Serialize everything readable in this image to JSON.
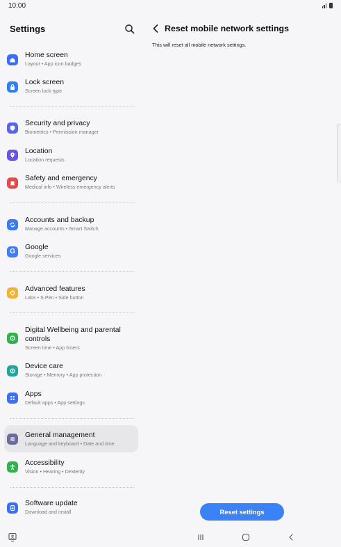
{
  "status": {
    "time": "10:00"
  },
  "left": {
    "title": "Settings",
    "items": [
      {
        "title": "Home screen",
        "subtitle": "Layout  •  App icon badges",
        "icon": "home-icon",
        "color": "#3b6ef5"
      },
      {
        "title": "Lock screen",
        "subtitle": "Screen lock type",
        "icon": "lock-icon",
        "color": "#2f80f0"
      },
      {
        "title": "Security and privacy",
        "subtitle": "Biometrics  •  Permission manager",
        "icon": "shield-icon",
        "color": "#5865e8"
      },
      {
        "title": "Location",
        "subtitle": "Location requests",
        "icon": "location-pin-icon",
        "color": "#6a55e0"
      },
      {
        "title": "Safety and emergency",
        "subtitle": "Medical info  •  Wireless emergency alerts",
        "icon": "emergency-icon",
        "color": "#e34a4a"
      },
      {
        "title": "Accounts and backup",
        "subtitle": "Manage accounts  •  Smart Switch",
        "icon": "sync-icon",
        "color": "#3a7cf0"
      },
      {
        "title": "Google",
        "subtitle": "Google services",
        "icon": "google-icon",
        "color": "#3d7ff2"
      },
      {
        "title": "Advanced features",
        "subtitle": "Labs  •  S Pen  •  Side button",
        "icon": "gear-plus-icon",
        "color": "#f2b233"
      },
      {
        "title": "Digital Wellbeing and parental controls",
        "subtitle": "Screen time  •  App timers",
        "icon": "wellbeing-icon",
        "color": "#2fb24c"
      },
      {
        "title": "Device care",
        "subtitle": "Storage  •  Memory  •  App protection",
        "icon": "device-care-icon",
        "color": "#1ea69a"
      },
      {
        "title": "Apps",
        "subtitle": "Default apps  •  App settings",
        "icon": "apps-grid-icon",
        "color": "#3d6ff0"
      },
      {
        "title": "General management",
        "subtitle": "Language and keyboard  •  Date and time",
        "icon": "sliders-icon",
        "color": "#6e6a9c"
      },
      {
        "title": "Accessibility",
        "subtitle": "Vision  •  Hearing  •  Dexterity",
        "icon": "accessibility-icon",
        "color": "#2fb24c"
      },
      {
        "title": "Software update",
        "subtitle": "Download and install",
        "icon": "software-update-icon",
        "color": "#3a6ff0"
      }
    ]
  },
  "right": {
    "title": "Reset mobile network settings",
    "description": "This will reset all mobile network settings.",
    "reset_label": "Reset settings"
  },
  "navbar": {
    "icons": [
      "screenshot-icon",
      "recent-apps-icon",
      "home-nav-icon",
      "back-nav-icon"
    ]
  }
}
